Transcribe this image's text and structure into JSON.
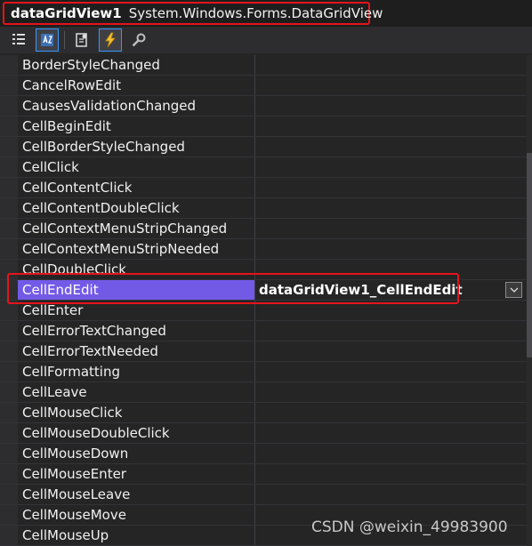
{
  "header": {
    "object_name": "dataGridView1",
    "object_type": "System.Windows.Forms.DataGridView"
  },
  "toolbar": {
    "buttons": [
      {
        "icon": "categorized-icon"
      },
      {
        "icon": "alphabetical-icon"
      },
      {
        "icon": "properties-icon"
      },
      {
        "icon": "events-icon"
      },
      {
        "icon": "property-pages-icon"
      }
    ]
  },
  "events": {
    "rows": [
      {
        "name": "BorderStyleChanged",
        "value": ""
      },
      {
        "name": "CancelRowEdit",
        "value": ""
      },
      {
        "name": "CausesValidationChanged",
        "value": ""
      },
      {
        "name": "CellBeginEdit",
        "value": ""
      },
      {
        "name": "CellBorderStyleChanged",
        "value": ""
      },
      {
        "name": "CellClick",
        "value": ""
      },
      {
        "name": "CellContentClick",
        "value": ""
      },
      {
        "name": "CellContentDoubleClick",
        "value": ""
      },
      {
        "name": "CellContextMenuStripChanged",
        "value": ""
      },
      {
        "name": "CellContextMenuStripNeeded",
        "value": ""
      },
      {
        "name": "CellDoubleClick",
        "value": ""
      },
      {
        "name": "CellEndEdit",
        "value": "dataGridView1_CellEndEdit",
        "selected": true
      },
      {
        "name": "CellEnter",
        "value": ""
      },
      {
        "name": "CellErrorTextChanged",
        "value": ""
      },
      {
        "name": "CellErrorTextNeeded",
        "value": ""
      },
      {
        "name": "CellFormatting",
        "value": ""
      },
      {
        "name": "CellLeave",
        "value": ""
      },
      {
        "name": "CellMouseClick",
        "value": ""
      },
      {
        "name": "CellMouseDoubleClick",
        "value": ""
      },
      {
        "name": "CellMouseDown",
        "value": ""
      },
      {
        "name": "CellMouseEnter",
        "value": ""
      },
      {
        "name": "CellMouseLeave",
        "value": ""
      },
      {
        "name": "CellMouseMove",
        "value": ""
      },
      {
        "name": "CellMouseUp",
        "value": ""
      }
    ]
  },
  "watermark": "CSDN @weixin_49983900",
  "colors": {
    "background": "#252526",
    "selection": "#735ae6",
    "annotation": "#e5141b"
  }
}
